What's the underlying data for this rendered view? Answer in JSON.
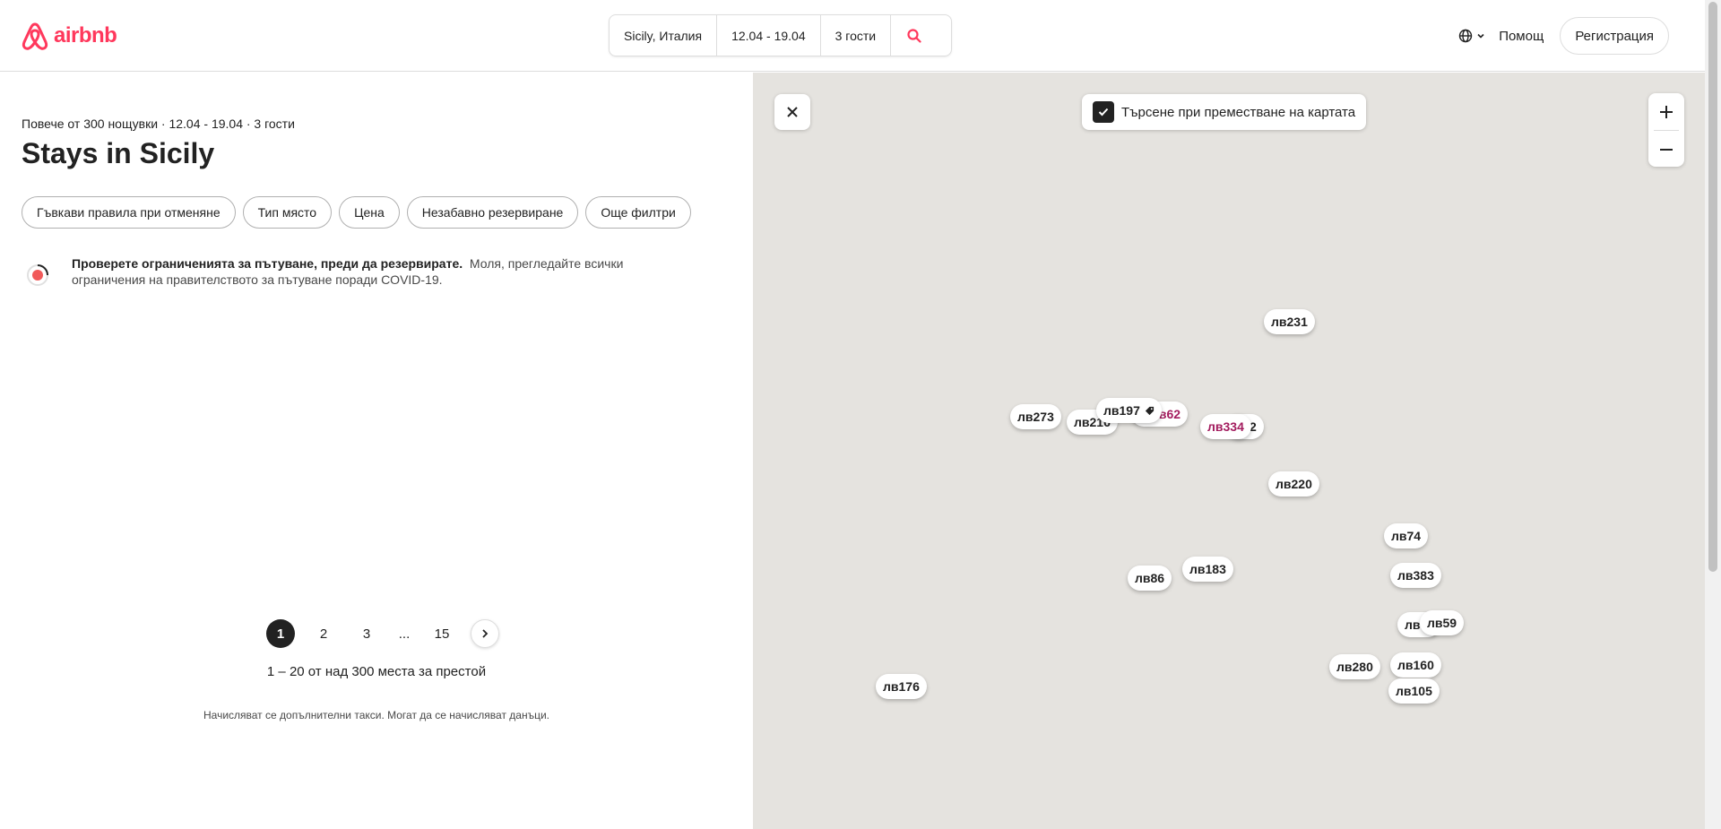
{
  "header": {
    "logo_text": "airbnb",
    "search": {
      "location": "Sicily, Италия",
      "dates": "12.04 - 19.04",
      "guests": "3 гости"
    },
    "help": "Помощ",
    "register": "Регистрация"
  },
  "results": {
    "subtitle": "Повече от 300 нощувки · 12.04 - 19.04 · 3 гости",
    "title": "Stays in Sicily",
    "filters": [
      "Гъвкави правила при отменяне",
      "Тип място",
      "Цена",
      "Незабавно резервиране",
      "Още филтри"
    ],
    "notice_bold": "Проверете ограниченията за пътуване, преди да резервирате.",
    "notice_text": "Моля, прегледайте всички ограничения на правителството за пътуване поради COVID-19.",
    "pages": [
      "1",
      "2",
      "3",
      "...",
      "15"
    ],
    "count": "1 – 20 от над 300 места за престой",
    "fees": "Начисляват се допълнителни такси. Могат да се начисляват данъци."
  },
  "map": {
    "search_on_move": "Търсене при преместване на картата",
    "search_on_move_checked": true,
    "pins": [
      "лв231",
      "лв273",
      "лв216",
      "лв62",
      "лв197",
      "2",
      "лв334",
      "лв220",
      "лв74",
      "лв183",
      "лв86",
      "лв383",
      "лв",
      "лв59",
      "лв280",
      "лв160",
      "лв105",
      "лв176"
    ]
  },
  "colors": {
    "brand": "#ff385c",
    "map_bg": "#e5e3df",
    "visited_pin": "#a31c5e"
  }
}
